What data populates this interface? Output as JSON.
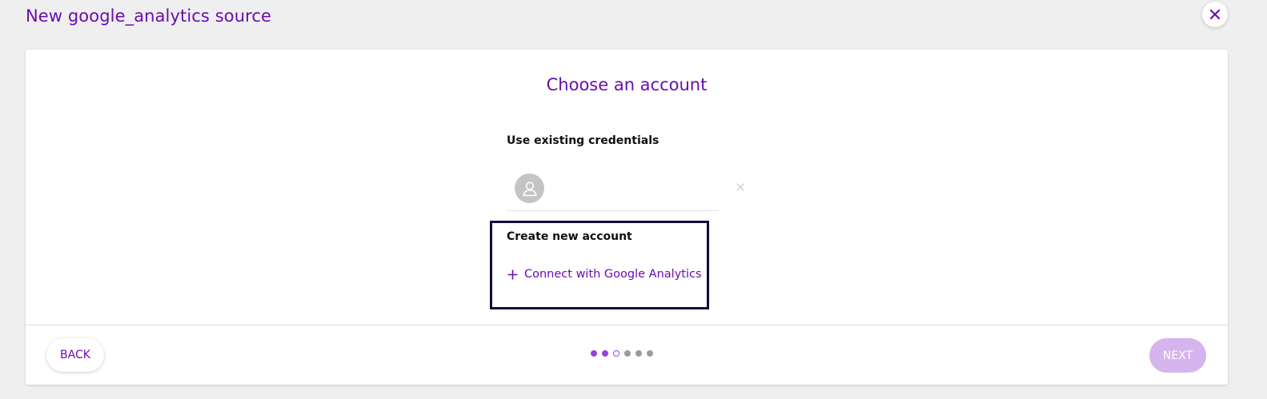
{
  "header": {
    "title": "New google_analytics source",
    "close_icon": "close-icon"
  },
  "wizard": {
    "step_title": "Choose an account",
    "existing_label": "Use existing credentials",
    "existing_credential": {
      "avatar_icon": "user-icon",
      "name": "",
      "remove_icon": "close-icon"
    },
    "new_label": "Create new account",
    "connect_label": "Connect with Google Analytics",
    "connect_icon": "plus-icon"
  },
  "footer": {
    "back_label": "BACK",
    "next_label": "NEXT",
    "next_enabled": false,
    "progress": {
      "total": 6,
      "current_step": 3,
      "steps": [
        "done",
        "done",
        "current",
        "todo",
        "todo",
        "todo"
      ]
    }
  },
  "colors": {
    "accent": "#6a0dad",
    "dot_done": "#9b3fdc",
    "dot_todo": "#9a9a9a",
    "next_disabled_bg": "#d6b4ee",
    "highlight_border": "#120b3a"
  }
}
